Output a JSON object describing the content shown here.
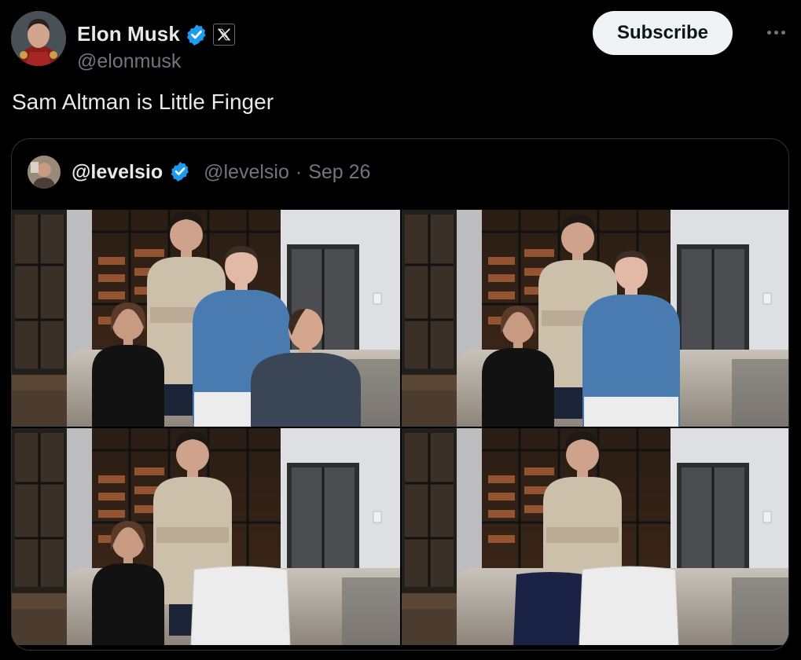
{
  "author": {
    "display_name": "Elon Musk",
    "handle": "@elonmusk",
    "avatar_icon": "profile-photo",
    "verified_icon": "verified-badge-icon",
    "affiliation_icon": "x-logo-icon"
  },
  "actions": {
    "subscribe_label": "Subscribe",
    "more_icon": "more-dots-icon"
  },
  "tweet": {
    "text": "Sam Altman is Little Finger"
  },
  "quoted": {
    "display_name": "@levelsio",
    "handle": "@levelsio",
    "separator": "·",
    "date": "Sep 26",
    "verified_icon": "verified-badge-icon"
  },
  "media": {
    "count": 4
  },
  "colors": {
    "background": "#000000",
    "text": "#e7e9ea",
    "muted": "#71767b",
    "verified": "#1d9bf0",
    "button_bg": "#eff3f4",
    "border": "#2f3336"
  }
}
